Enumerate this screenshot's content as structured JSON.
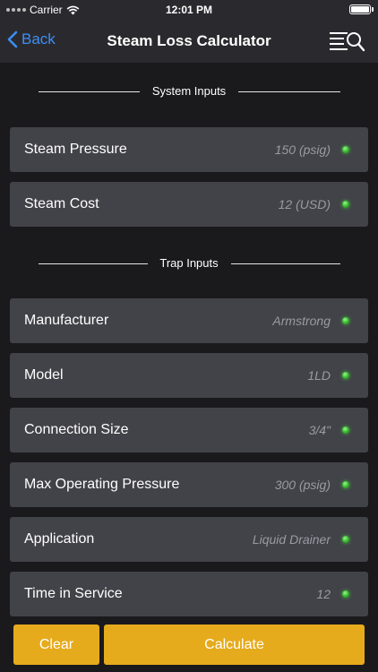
{
  "status_bar": {
    "carrier": "Carrier",
    "time": "12:01 PM"
  },
  "nav": {
    "back_label": "Back",
    "title": "Steam Loss Calculator",
    "accent_color": "#3d8ef5",
    "right_icon": "list-search-icon"
  },
  "system_inputs": {
    "header": "System Inputs",
    "rows": [
      {
        "label": "Steam Pressure",
        "value": "150 (psig)"
      },
      {
        "label": "Steam Cost",
        "value": "12 (USD)"
      }
    ]
  },
  "trap_inputs": {
    "header": "Trap Inputs",
    "rows": [
      {
        "label": "Manufacturer",
        "value": "Armstrong"
      },
      {
        "label": "Model",
        "value": "1LD"
      },
      {
        "label": "Connection Size",
        "value": "3/4\""
      },
      {
        "label": "Max Operating Pressure",
        "value": "300 (psig)"
      },
      {
        "label": "Application",
        "value": "Liquid Drainer"
      },
      {
        "label": "Time in Service",
        "value": "12"
      }
    ]
  },
  "status_indicator_color": "#3fbf34",
  "buttons": {
    "clear_label": "Clear",
    "calculate_label": "Calculate",
    "button_color": "#e6ab1c"
  }
}
